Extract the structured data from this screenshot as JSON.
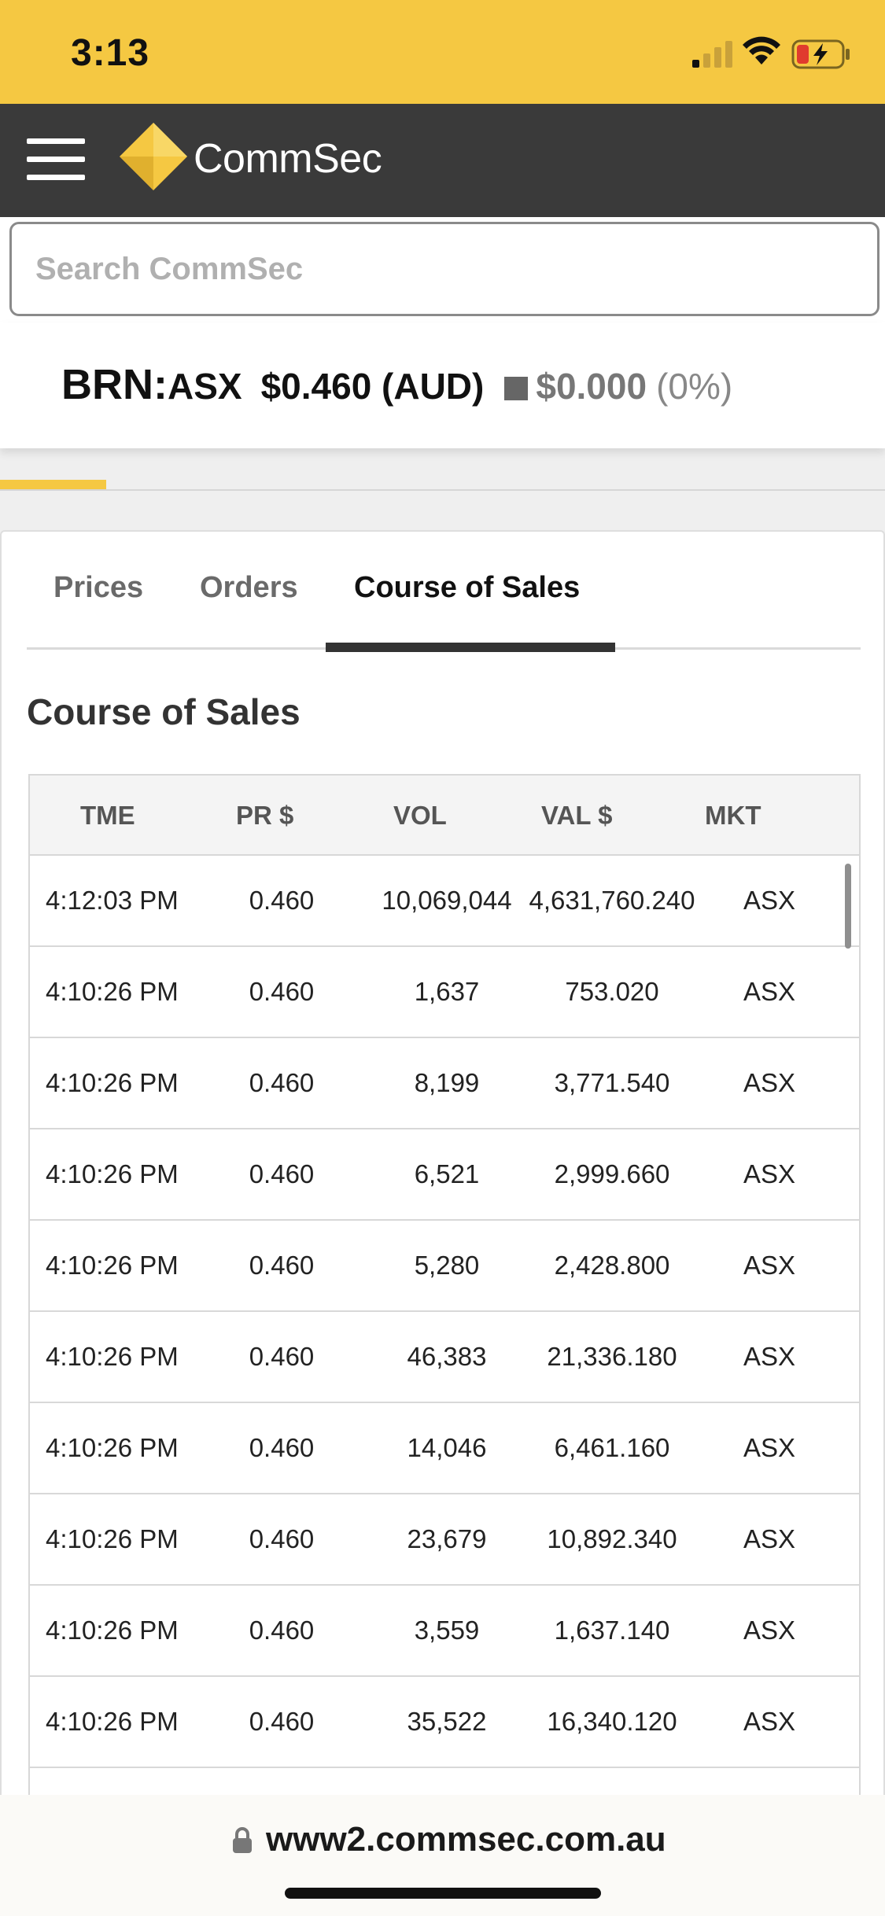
{
  "status_bar": {
    "time": "3:13"
  },
  "header": {
    "brand": "CommSec",
    "brand_color": "#f5c842"
  },
  "search": {
    "placeholder": "Search CommSec",
    "value": ""
  },
  "quote": {
    "ticker": "BRN:",
    "exchange": "ASX",
    "price": "$0.460 (AUD)",
    "change": "$0.000",
    "change_pct": "(0%)"
  },
  "progress": {
    "fill_fraction": 0.12
  },
  "tabs": [
    {
      "label": "Prices",
      "active": false
    },
    {
      "label": "Orders",
      "active": false
    },
    {
      "label": "Course of Sales",
      "active": true
    }
  ],
  "section_title": "Course of Sales",
  "table": {
    "headers": [
      "TME",
      "PR $",
      "VOL",
      "VAL $",
      "MKT"
    ],
    "rows": [
      [
        "4:12:03 PM",
        "0.460",
        "10,069,044",
        "4,631,760.240",
        "ASX"
      ],
      [
        "4:10:26 PM",
        "0.460",
        "1,637",
        "753.020",
        "ASX"
      ],
      [
        "4:10:26 PM",
        "0.460",
        "8,199",
        "3,771.540",
        "ASX"
      ],
      [
        "4:10:26 PM",
        "0.460",
        "6,521",
        "2,999.660",
        "ASX"
      ],
      [
        "4:10:26 PM",
        "0.460",
        "5,280",
        "2,428.800",
        "ASX"
      ],
      [
        "4:10:26 PM",
        "0.460",
        "46,383",
        "21,336.180",
        "ASX"
      ],
      [
        "4:10:26 PM",
        "0.460",
        "14,046",
        "6,461.160",
        "ASX"
      ],
      [
        "4:10:26 PM",
        "0.460",
        "23,679",
        "10,892.340",
        "ASX"
      ],
      [
        "4:10:26 PM",
        "0.460",
        "3,559",
        "1,637.140",
        "ASX"
      ],
      [
        "4:10:26 PM",
        "0.460",
        "35,522",
        "16,340.120",
        "ASX"
      ]
    ]
  },
  "browser": {
    "url": "www2.commsec.com.au"
  }
}
